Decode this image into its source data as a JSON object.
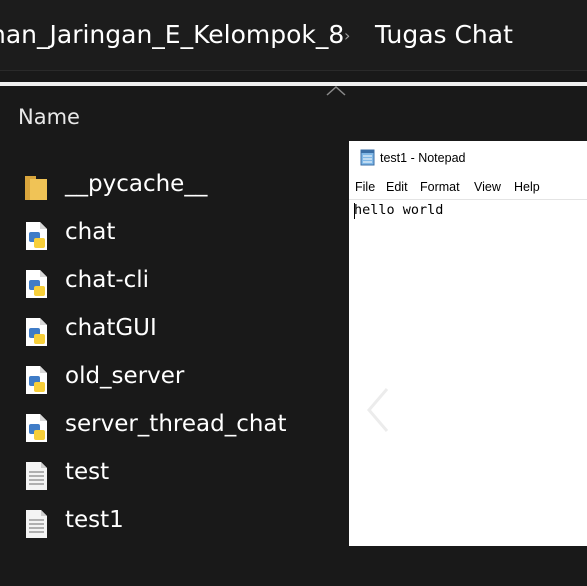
{
  "breadcrumb": {
    "parent": "nan_Jaringan_E_Kelompok_8",
    "separator": "›",
    "current": "Tugas Chat"
  },
  "column_header": "Name",
  "files": [
    {
      "name": "__pycache__",
      "icon": "folder-icon"
    },
    {
      "name": "chat",
      "icon": "python-file-icon"
    },
    {
      "name": "chat-cli",
      "icon": "python-file-icon"
    },
    {
      "name": "chatGUI",
      "icon": "python-file-icon"
    },
    {
      "name": "old_server",
      "icon": "python-file-icon"
    },
    {
      "name": "server_thread_chat",
      "icon": "python-file-icon"
    },
    {
      "name": "test",
      "icon": "text-file-icon"
    },
    {
      "name": "test1",
      "icon": "text-file-icon"
    }
  ],
  "notepad": {
    "title": "test1 - Notepad",
    "menu": [
      "File",
      "Edit",
      "Format",
      "View",
      "Help"
    ],
    "content": "hello world"
  },
  "colors": {
    "background": "#191919",
    "folder": "#e8b84a",
    "python_blue": "#3f7cc7",
    "python_yellow": "#f7cf3a"
  }
}
